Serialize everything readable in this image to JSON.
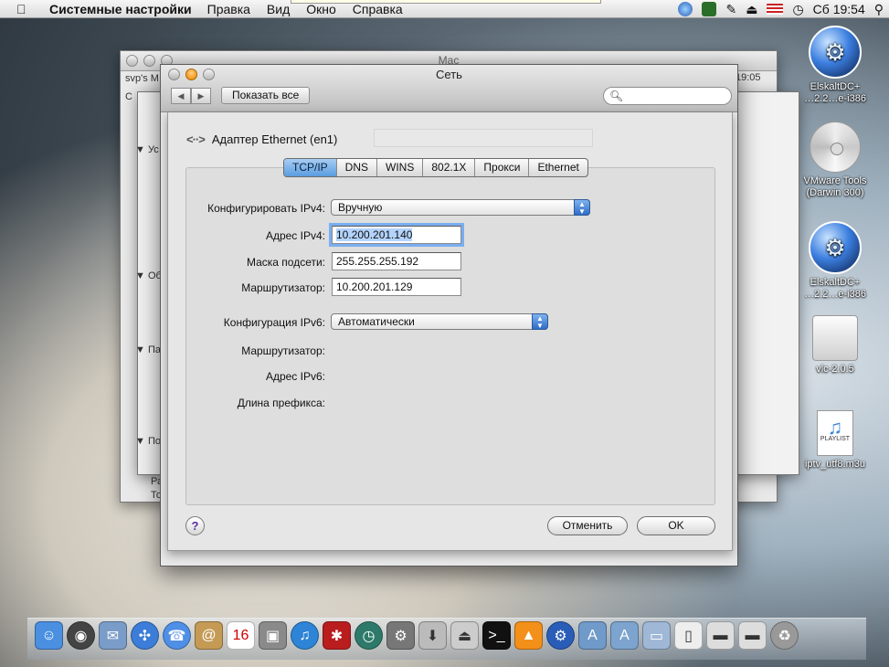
{
  "menubar": {
    "app_name": "Системные настройки",
    "items": [
      "Правка",
      "Вид",
      "Окно",
      "Справка"
    ],
    "clock": "Сб 19:54"
  },
  "background_windows": {
    "mac_title": "Mac",
    "clock": "19:05",
    "label_svp": "svp's M",
    "label_c": "C",
    "label_yc": "▼ Ус",
    "label_ob": "▼ Об",
    "label_pa": "▼ Па",
    "label_po": "▼ По",
    "label_ra": "Ра",
    "label_to": "То"
  },
  "window": {
    "title": "Сеть",
    "show_all": "Показать все",
    "search_placeholder": ""
  },
  "sheet": {
    "adapter_label": "Адаптер Ethernet (en1)",
    "tabs": [
      "TCP/IP",
      "DNS",
      "WINS",
      "802.1X",
      "Прокси",
      "Ethernet"
    ],
    "active_tab": "TCP/IP",
    "fields": {
      "ipv4_config_label": "Конфигурировать IPv4:",
      "ipv4_config_value": "Вручную",
      "ipv4_address_label": "Адрес IPv4:",
      "ipv4_address_value": "10.200.201.140",
      "subnet_label": "Маска подсети:",
      "subnet_value": "255.255.255.192",
      "router_label": "Маршрутизатор:",
      "router_value": "10.200.201.129",
      "ipv6_config_label": "Конфигурация IPv6:",
      "ipv6_config_value": "Автоматически",
      "ipv6_router_label": "Маршрутизатор:",
      "ipv6_address_label": "Адрес IPv6:",
      "prefix_label": "Длина префикса:"
    },
    "help": "?",
    "cancel": "Отменить",
    "ok": "OK"
  },
  "desktop_icons": [
    {
      "label1": "ElskaltDC+",
      "label2": "…2.2…e-i386"
    },
    {
      "label1": "VMware Tools",
      "label2": "(Darwin 300)"
    },
    {
      "label1": "ElskaltDC+",
      "label2": "…2.2…e-i386"
    },
    {
      "label1": "vlc-2.0.5",
      "label2": ""
    },
    {
      "label1": "iptv_utf8.m3u",
      "label2": ""
    }
  ],
  "playlist_badge": "PLAYLIST",
  "colors": {
    "accent": "#5a9ce0",
    "focus_ring": "#7aaef0"
  }
}
